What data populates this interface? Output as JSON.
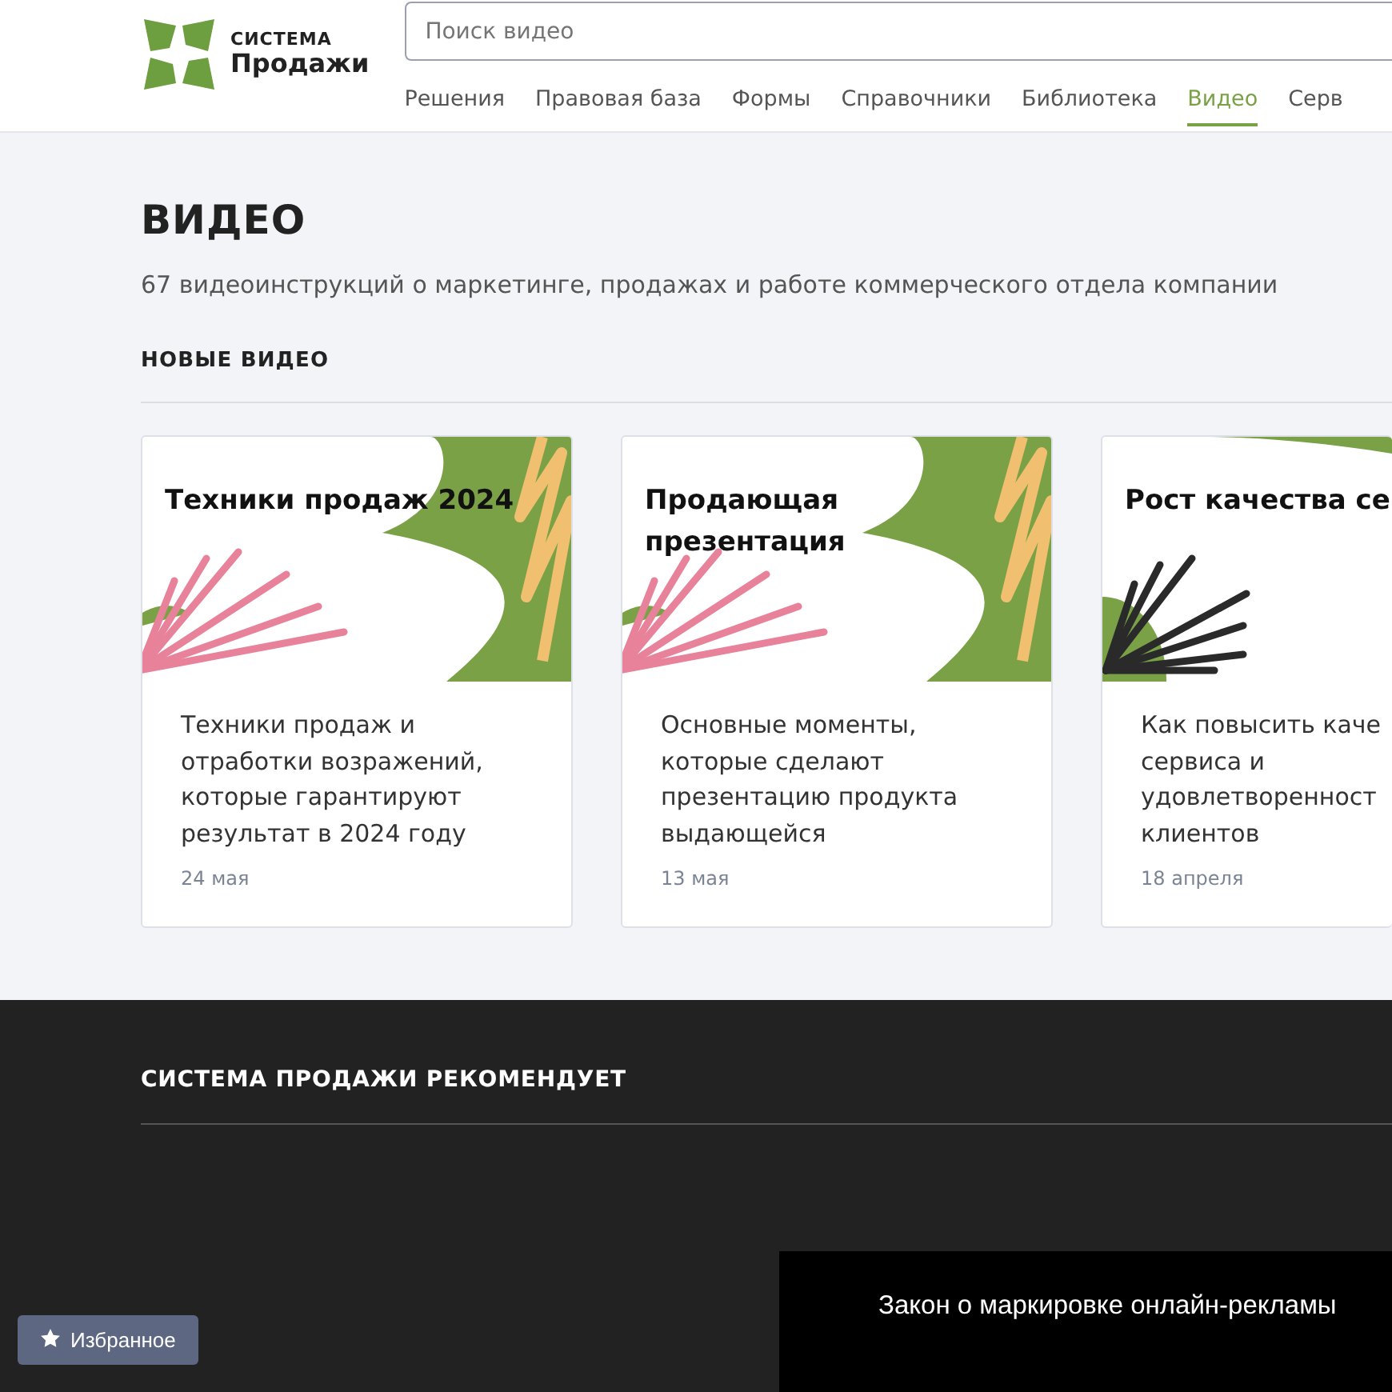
{
  "header": {
    "logo": {
      "line1": "СИСТЕМА",
      "line2": "Продажи"
    },
    "search": {
      "placeholder": "Поиск видео"
    },
    "nav": [
      {
        "label": "Решения",
        "selected": false
      },
      {
        "label": "Правовая база",
        "selected": false
      },
      {
        "label": "Формы",
        "selected": false
      },
      {
        "label": "Справочники",
        "selected": false
      },
      {
        "label": "Библиотека",
        "selected": false
      },
      {
        "label": "Видео",
        "selected": true
      },
      {
        "label": "Серв",
        "selected": false
      }
    ]
  },
  "page": {
    "title": "ВИДЕО",
    "subtitle": "67 видеоинструкций о маркетинге, продажах и работе коммерческого отдела компании",
    "section": "НОВЫЕ ВИДЕО"
  },
  "videos": [
    {
      "title": "Техники продаж 2024",
      "description": "Техники продаж и отработки возражений, которые гарантируют результат в 2024 году",
      "date": "24 мая",
      "kind": "pink"
    },
    {
      "title": "Продающая презентация",
      "description": "Основные моменты, которые сделают презентацию продукта выдающейся",
      "date": "13 мая",
      "kind": "pink"
    },
    {
      "title": "Рост качества се",
      "description": "Как повысить каче сервиса и удовлетворенност клиентов",
      "date": "18 апреля",
      "kind": "black"
    }
  ],
  "recommend": {
    "title": "СИСТЕМА ПРОДАЖИ РЕКОМЕНДУЕТ"
  },
  "favorites_button": "Избранное",
  "banner": {
    "text": "Закон о маркировке онлайн-рекламы"
  }
}
